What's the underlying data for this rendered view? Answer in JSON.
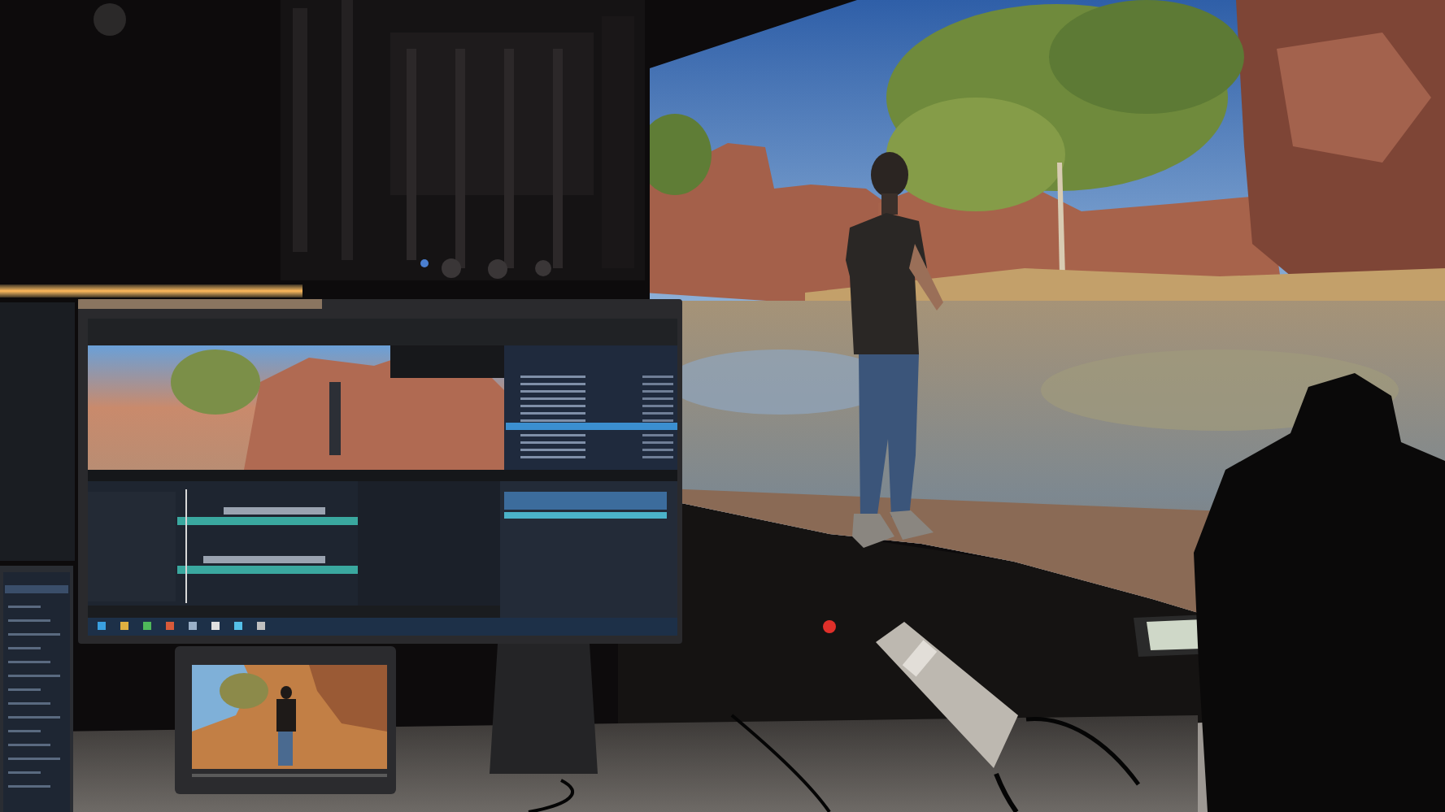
{
  "photo": {
    "kind": "photograph"
  }
}
